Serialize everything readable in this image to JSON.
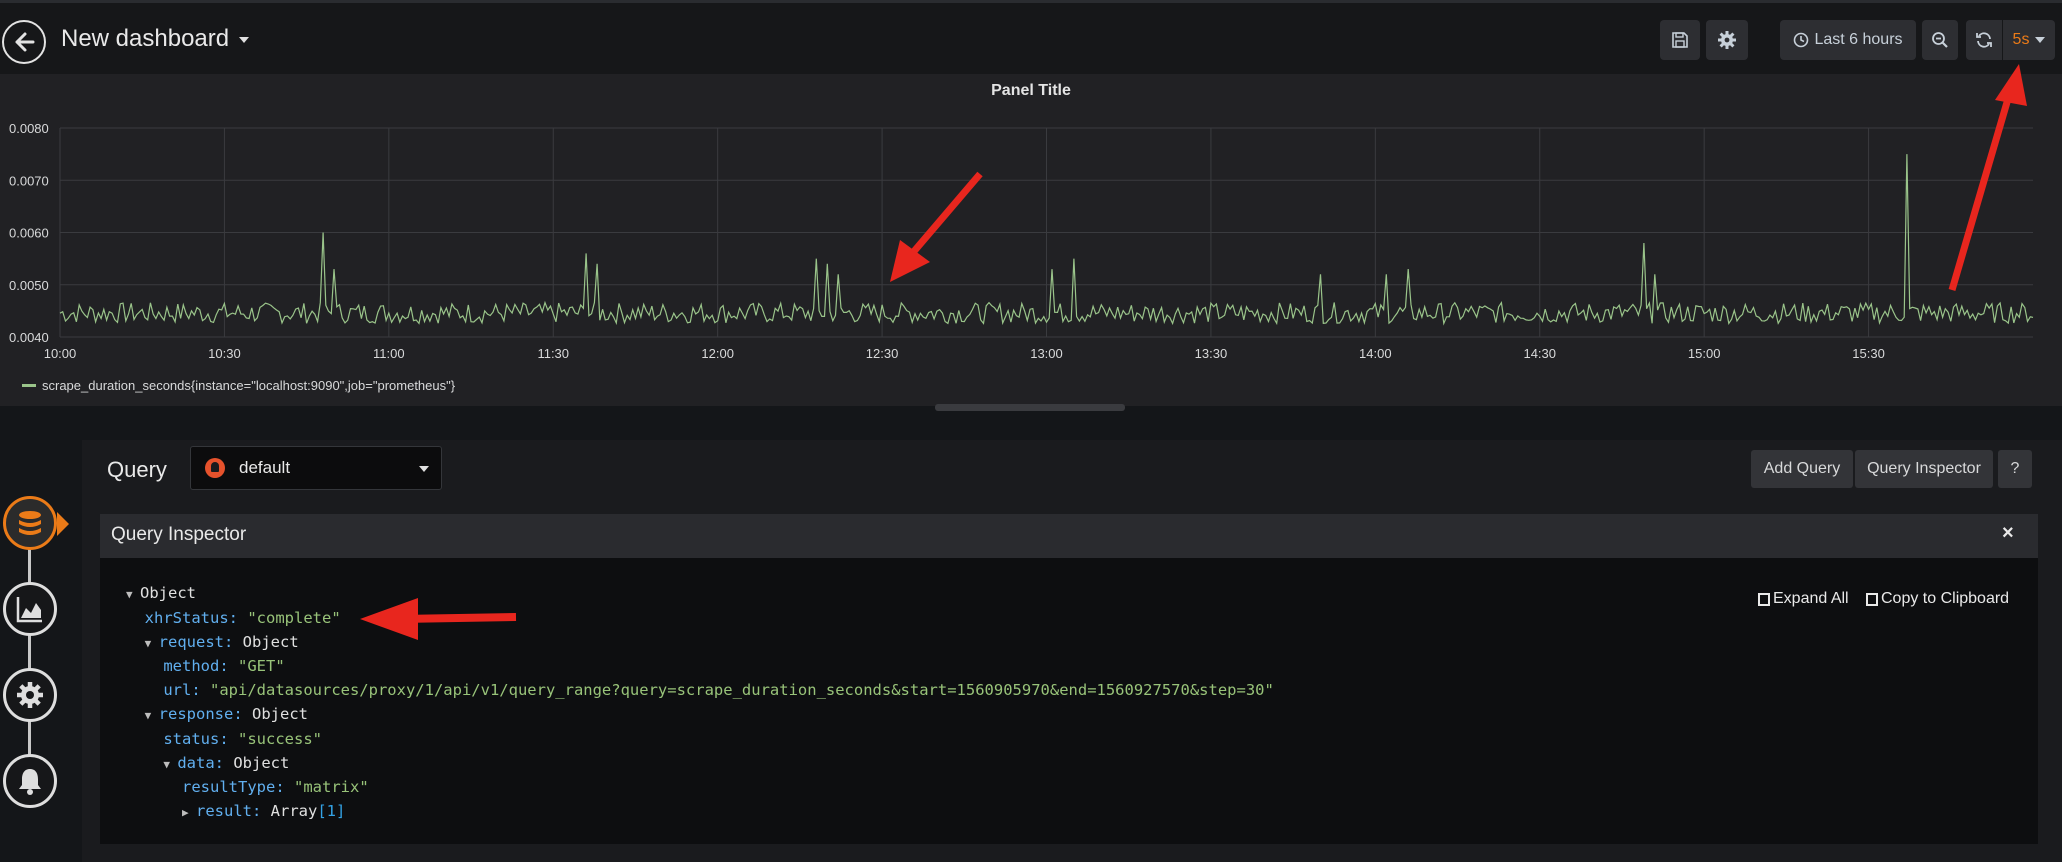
{
  "navbar": {
    "title": "New dashboard",
    "time_range": "Last 6 hours",
    "refresh_interval": "5s"
  },
  "panel": {
    "title": "Panel Title",
    "legend": "scrape_duration_seconds{instance=\"localhost:9090\",job=\"prometheus\"}"
  },
  "chart_data": {
    "type": "line",
    "title": "Panel Title",
    "y_ticks": [
      "0.0080",
      "0.0070",
      "0.0060",
      "0.0050",
      "0.0040"
    ],
    "x_ticks": [
      "10:00",
      "10:30",
      "11:00",
      "11:30",
      "12:00",
      "12:30",
      "13:00",
      "13:30",
      "14:00",
      "14:30",
      "15:00",
      "15:30"
    ],
    "ylim": [
      0.004,
      0.008
    ],
    "xlim_hours": [
      "10:00",
      "16:00"
    ],
    "grid": true,
    "legend_position": "bottom-left",
    "series": [
      {
        "name": "scrape_duration_seconds{instance=\"localhost:9090\",job=\"prometheus\"}",
        "color": "#9ac48a",
        "baseline": 0.0044,
        "spikes": [
          {
            "t": "10:48",
            "v": 0.006
          },
          {
            "t": "10:50",
            "v": 0.0053
          },
          {
            "t": "11:36",
            "v": 0.0056
          },
          {
            "t": "11:38",
            "v": 0.0054
          },
          {
            "t": "12:18",
            "v": 0.0055
          },
          {
            "t": "12:20",
            "v": 0.0054
          },
          {
            "t": "12:22",
            "v": 0.0052
          },
          {
            "t": "13:01",
            "v": 0.0053
          },
          {
            "t": "13:05",
            "v": 0.0055
          },
          {
            "t": "13:50",
            "v": 0.0052
          },
          {
            "t": "14:02",
            "v": 0.0052
          },
          {
            "t": "14:06",
            "v": 0.0053
          },
          {
            "t": "14:49",
            "v": 0.0058
          },
          {
            "t": "14:51",
            "v": 0.0052
          },
          {
            "t": "15:37",
            "v": 0.0075
          }
        ]
      }
    ]
  },
  "query": {
    "label": "Query",
    "datasource": "default",
    "add_query": "Add Query",
    "query_inspector": "Query Inspector",
    "help": "?"
  },
  "inspector": {
    "title": "Query Inspector",
    "close": "×",
    "expand_all": "Expand All",
    "copy": "Copy to Clipboard",
    "tree": {
      "root": "Object",
      "xhr_key": "xhrStatus",
      "xhr_val": "\"complete\"",
      "request_key": "request",
      "request_val": "Object",
      "method_key": "method",
      "method_val": "\"GET\"",
      "url_key": "url",
      "url_val": "\"api/datasources/proxy/1/api/v1/query_range?query=scrape_duration_seconds&start=1560905970&end=1560927570&step=30\"",
      "response_key": "response",
      "response_val": "Object",
      "status_key": "status",
      "status_val": "\"success\"",
      "data_key": "data",
      "data_val": "Object",
      "rtype_key": "resultType",
      "rtype_val": "\"matrix\"",
      "result_key": "result",
      "result_val": "Array",
      "result_len": "[1]"
    }
  }
}
